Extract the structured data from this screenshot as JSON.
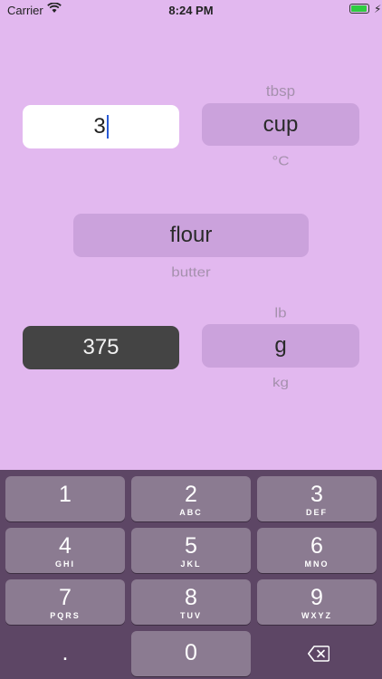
{
  "status_bar": {
    "carrier": "Carrier",
    "time": "8:24 PM"
  },
  "converter": {
    "amount_value": "3",
    "from_unit": {
      "selected": "cup",
      "above": "tbsp",
      "below": "°C"
    },
    "ingredient": {
      "selected": "flour",
      "below": "butter"
    },
    "to_unit": {
      "selected": "g",
      "above": "lb",
      "below": "kg"
    },
    "result_value": "375"
  },
  "keypad": {
    "keys": [
      {
        "num": "1",
        "letters": ""
      },
      {
        "num": "2",
        "letters": "ABC"
      },
      {
        "num": "3",
        "letters": "DEF"
      },
      {
        "num": "4",
        "letters": "GHI"
      },
      {
        "num": "5",
        "letters": "JKL"
      },
      {
        "num": "6",
        "letters": "MNO"
      },
      {
        "num": "7",
        "letters": "PQRS"
      },
      {
        "num": "8",
        "letters": "TUV"
      },
      {
        "num": "9",
        "letters": "WXYZ"
      }
    ],
    "decimal": ".",
    "zero": "0"
  },
  "colors": {
    "background": "#e2b8ef",
    "picker_selection": "#cba2dc",
    "result_bg": "#444444",
    "keyboard_bg": "#5d4665",
    "key_bg": "#8b7b91"
  }
}
